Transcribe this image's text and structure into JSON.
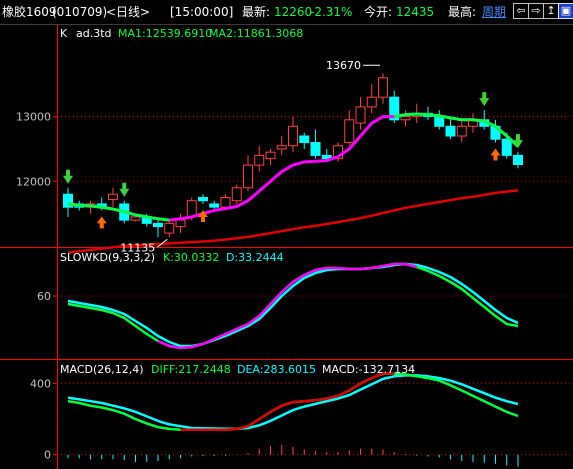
{
  "topbar": {
    "symbol": "橡胶1609",
    "code": "(010709)",
    "period": "<日线>",
    "time": "[15:00:00]",
    "last_label": "最新:",
    "last_value": "12260",
    "change_pct": "-2.31%",
    "open_label": "今开:",
    "open_value": "12435",
    "high_label": "最高:",
    "high_link": "周期",
    "buttons": [
      "⇦",
      "⇨",
      "↥",
      "▣"
    ]
  },
  "colors": {
    "up": "#ff4040",
    "down": "#00ffff",
    "ma1": "#ff00ff",
    "ma2": "#e00000",
    "green": "#00ff40",
    "grid": "#c00000",
    "axis": "#ff0000",
    "yellow": "#ffff00",
    "cyan": "#00ffff",
    "white": "#ffffff",
    "arrow_up": "#ff6a00",
    "arrow_down": "#3cd23c"
  },
  "chart_data": [
    {
      "type": "candlestick",
      "panel": "main",
      "legend": {
        "k": "K",
        "adj": "ad.3td",
        "ma1": "MA1:12539.6910",
        "ma2": "MA2:11861.3068"
      },
      "yticks": [
        12000,
        13000
      ],
      "ylim": [
        11000,
        14400
      ],
      "annotations": {
        "high": "13670",
        "low": "11135"
      },
      "candles": [
        [
          11800,
          11900,
          11450,
          11600
        ],
        [
          11650,
          11700,
          11550,
          11600
        ],
        [
          11600,
          11700,
          11500,
          11650
        ],
        [
          11650,
          11750,
          11550,
          11600
        ],
        [
          11720,
          11900,
          11600,
          11800
        ],
        [
          11650,
          11700,
          11350,
          11400
        ],
        [
          11400,
          11500,
          11380,
          11450
        ],
        [
          11450,
          11500,
          11300,
          11350
        ],
        [
          11350,
          11400,
          11135,
          11300
        ],
        [
          11200,
          11400,
          11135,
          11350
        ],
        [
          11300,
          11500,
          11200,
          11400
        ],
        [
          11450,
          11750,
          11400,
          11700
        ],
        [
          11750,
          11800,
          11650,
          11700
        ],
        [
          11650,
          11700,
          11550,
          11600
        ],
        [
          11600,
          11800,
          11550,
          11750
        ],
        [
          11700,
          11950,
          11650,
          11900
        ],
        [
          11900,
          12400,
          11850,
          12250
        ],
        [
          12250,
          12550,
          12150,
          12400
        ],
        [
          12350,
          12500,
          12250,
          12450
        ],
        [
          12500,
          12700,
          12400,
          12550
        ],
        [
          12550,
          13000,
          12450,
          12850
        ],
        [
          12700,
          12750,
          12500,
          12600
        ],
        [
          12600,
          12800,
          12350,
          12400
        ],
        [
          12400,
          12500,
          12300,
          12350
        ],
        [
          12350,
          12600,
          12300,
          12550
        ],
        [
          12600,
          13100,
          12550,
          12950
        ],
        [
          12900,
          13300,
          12800,
          13150
        ],
        [
          13150,
          13500,
          13050,
          13300
        ],
        [
          13300,
          13670,
          13200,
          13600
        ],
        [
          13300,
          13400,
          12900,
          12950
        ],
        [
          12950,
          13100,
          12850,
          13000
        ],
        [
          13000,
          13200,
          12900,
          13050
        ],
        [
          13050,
          13150,
          12950,
          13000
        ],
        [
          13000,
          13100,
          12800,
          12850
        ],
        [
          12850,
          13000,
          12650,
          12700
        ],
        [
          12700,
          12950,
          12600,
          12850
        ],
        [
          12850,
          13050,
          12750,
          12950
        ],
        [
          12950,
          13100,
          12800,
          12850
        ],
        [
          12850,
          12950,
          12600,
          12650
        ],
        [
          12650,
          12750,
          12350,
          12400
        ],
        [
          12400,
          12450,
          12200,
          12260
        ]
      ],
      "ma1": [
        11650,
        11630,
        11620,
        11600,
        11570,
        11530,
        11480,
        11450,
        11420,
        11400,
        11420,
        11450,
        11500,
        11550,
        11580,
        11610,
        11700,
        11850,
        12000,
        12150,
        12250,
        12300,
        12310,
        12320,
        12380,
        12500,
        12700,
        12900,
        13000,
        13000,
        13030,
        13040,
        13030,
        13010,
        12980,
        12950,
        12950,
        12930,
        12850,
        12700,
        12540
      ],
      "ma2": [
        10900,
        10920,
        10940,
        10960,
        10980,
        11000,
        11010,
        11020,
        11030,
        11040,
        11050,
        11060,
        11070,
        11080,
        11100,
        11120,
        11140,
        11170,
        11200,
        11230,
        11260,
        11290,
        11310,
        11340,
        11370,
        11400,
        11430,
        11470,
        11510,
        11550,
        11590,
        11620,
        11650,
        11680,
        11710,
        11740,
        11760,
        11790,
        11820,
        11840,
        11860
      ],
      "down_arrows": [
        0,
        5,
        37,
        40
      ],
      "up_arrows": [
        3,
        12,
        38
      ]
    },
    {
      "type": "line",
      "panel": "slowkd",
      "legend": {
        "name": "SLOWKD(9,3,3,2)",
        "k": "K:30.0332",
        "d": "D:33.2444"
      },
      "yticks": [
        60
      ],
      "ylim": [
        0,
        100
      ],
      "k": [
        52,
        50,
        48,
        46,
        43,
        38,
        30,
        22,
        15,
        10,
        8,
        9,
        12,
        17,
        22,
        27,
        32,
        40,
        52,
        64,
        74,
        81,
        86,
        88,
        88,
        87,
        87,
        88,
        90,
        92,
        92,
        89,
        85,
        80,
        74,
        67,
        58,
        49,
        40,
        32,
        30
      ],
      "d": [
        55,
        53,
        51,
        49,
        46,
        42,
        35,
        28,
        20,
        14,
        10,
        10,
        12,
        16,
        20,
        25,
        30,
        37,
        48,
        60,
        70,
        78,
        83,
        86,
        87,
        87,
        87,
        88,
        89,
        91,
        92,
        91,
        88,
        84,
        79,
        72,
        64,
        55,
        46,
        38,
        33
      ]
    },
    {
      "type": "line",
      "panel": "macd",
      "legend": {
        "name": "MACD(26,12,4)",
        "diff": "DIFF:217.2448",
        "dea": "DEA:283.6015",
        "macd": "MACD:-132.7134"
      },
      "yticks": [
        400,
        0
      ],
      "ylim": [
        -80,
        520
      ],
      "diff": [
        300,
        290,
        275,
        265,
        250,
        230,
        200,
        175,
        155,
        145,
        140,
        140,
        140,
        140,
        140,
        145,
        160,
        200,
        240,
        275,
        295,
        300,
        305,
        315,
        330,
        360,
        400,
        430,
        455,
        455,
        450,
        440,
        430,
        415,
        390,
        360,
        330,
        300,
        270,
        240,
        217
      ],
      "dea": [
        320,
        310,
        300,
        290,
        275,
        260,
        240,
        215,
        190,
        170,
        160,
        150,
        148,
        147,
        146,
        146,
        150,
        165,
        190,
        220,
        250,
        270,
        285,
        300,
        315,
        335,
        365,
        395,
        425,
        440,
        445,
        445,
        440,
        430,
        415,
        395,
        370,
        345,
        320,
        300,
        284
      ],
      "hist": [
        -20,
        -20,
        -25,
        -25,
        -25,
        -30,
        -40,
        -40,
        -35,
        -25,
        -20,
        -10,
        -8,
        -7,
        -6,
        -1,
        10,
        35,
        50,
        55,
        45,
        30,
        20,
        15,
        15,
        25,
        35,
        35,
        30,
        15,
        5,
        -5,
        -10,
        -15,
        -25,
        -35,
        -40,
        -45,
        -50,
        -60,
        -67
      ]
    }
  ]
}
